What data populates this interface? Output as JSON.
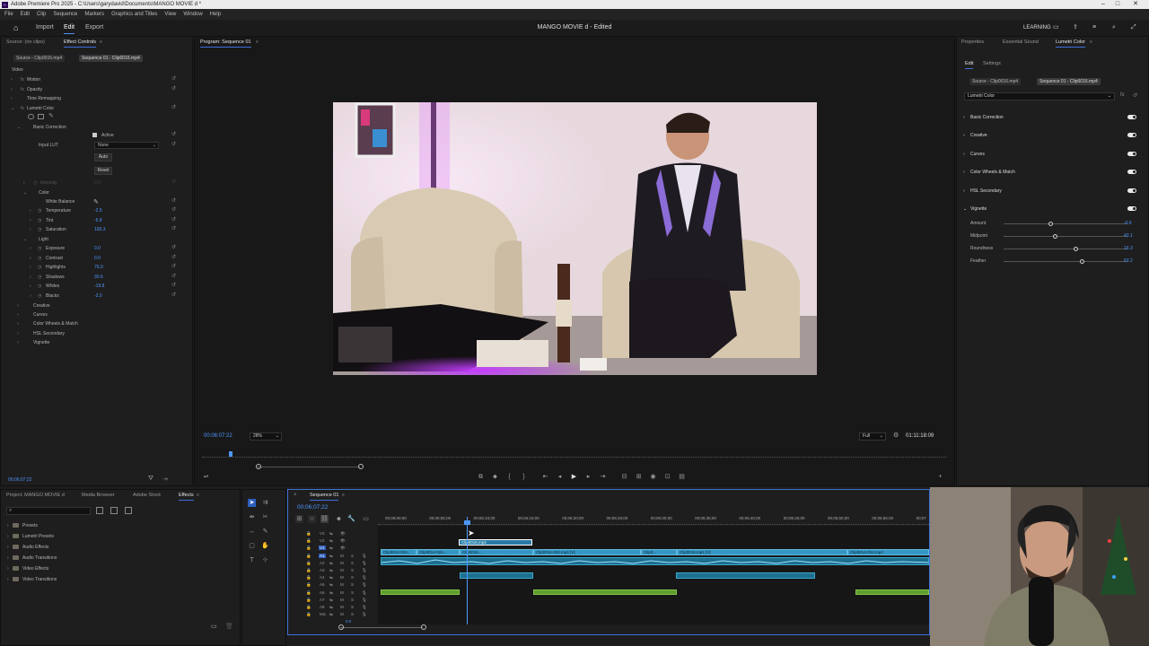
{
  "titlebar": {
    "title": "Adobe Premiere Pro 2025 - C:\\Users\\garydavid\\Documents\\MANGO MOVIE d *"
  },
  "menu": [
    "File",
    "Edit",
    "Clip",
    "Sequence",
    "Markers",
    "Graphics and Titles",
    "View",
    "Window",
    "Help"
  ],
  "workspace": {
    "tabs": [
      "Import",
      "Edit",
      "Export"
    ],
    "active_tab": "Edit",
    "project_title": "MANGO MOVIE d - Edited",
    "learning_label": "LEARNING"
  },
  "effect_controls": {
    "tabs": [
      "Source: (no clips)",
      "Effect Controls"
    ],
    "source_chip": "Source - Clip0016.mp4",
    "sequence_chip": "Sequence 01 - Clip0016.mp4",
    "section_video": "Video",
    "effects": [
      "Motion",
      "Opacity",
      "Time Remapping",
      "Lumetri Color"
    ],
    "basic_correction": "Basic Correction",
    "active_label": "Active",
    "input_lut_label": "Input LUT",
    "input_lut_value": "None",
    "auto_label": "Auto",
    "reset_label": "Reset",
    "intensity_label": "Intensity",
    "intensity_value": "0.0",
    "color_label": "Color",
    "white_balance_label": "White Balance",
    "color_params": [
      {
        "label": "Temperature",
        "value": "-2.5"
      },
      {
        "label": "Tint",
        "value": "-5.8"
      },
      {
        "label": "Saturation",
        "value": "100.3"
      }
    ],
    "light_label": "Light",
    "light_params": [
      {
        "label": "Exposure",
        "value": "0.0"
      },
      {
        "label": "Contrast",
        "value": "0.0"
      },
      {
        "label": "Highlights",
        "value": "76.0"
      },
      {
        "label": "Shadows",
        "value": "30.6"
      },
      {
        "label": "Whites",
        "value": "-19.8"
      },
      {
        "label": "Blacks",
        "value": "-2.0"
      }
    ],
    "sections": [
      "Creative",
      "Curves",
      "Color Wheels & Match",
      "HSL Secondary",
      "Vignette"
    ],
    "timecode": "00;06;07;22"
  },
  "program": {
    "title": "Program: Sequence 01",
    "timecode": "00:06:07:22",
    "zoom": "28%",
    "quality": "Full",
    "duration": "01:11:18:09"
  },
  "lumetri": {
    "tabs": [
      "Properties",
      "Essential Sound",
      "Lumetri Color"
    ],
    "subtabs": [
      "Edit",
      "Settings"
    ],
    "source_chip": "Source - Clip0016.mp4",
    "sequence_chip": "Sequence 01 - Clip0016.mp4",
    "effect_select": "Lumetri Color",
    "sections": [
      "Basic Correction",
      "Creative",
      "Curves",
      "Color Wheels & Match",
      "HSL Secondary",
      "Vignette"
    ],
    "vignette": [
      {
        "label": "Amount",
        "value": "-0.6",
        "pos": 0.38
      },
      {
        "label": "Midpoint",
        "value": "43.1",
        "pos": 0.41
      },
      {
        "label": "Roundness",
        "value": "16.3",
        "pos": 0.58
      },
      {
        "label": "Feather",
        "value": "63.2",
        "pos": 0.63
      }
    ]
  },
  "project": {
    "tabs": [
      "Project: MANGO MOVIE d",
      "Media Browser",
      "Adobe Stock",
      "Effects"
    ],
    "folders": [
      "Presets",
      "Lumetri Presets",
      "Audio Effects",
      "Audio Transitions",
      "Video Effects",
      "Video Transitions"
    ]
  },
  "timeline": {
    "title": "Sequence 01",
    "timecode": "00;06;07;22",
    "ruler": [
      "00;06;00;00",
      "00;06;05;00",
      "00;06;10;00",
      "00;06;15;00",
      "00;06;20;00",
      "00;06;25;00",
      "00;06;30;00",
      "00;06;35;00",
      "00;06;40;00",
      "00;06;45;00",
      "00;06;50;00",
      "00;06;55;00",
      "00;07"
    ],
    "tracks_video": [
      "V3",
      "V2",
      "V1"
    ],
    "tracks_audio": [
      "A1",
      "A2",
      "A3",
      "A4",
      "A5",
      "A6",
      "A7",
      "A8",
      "Mix"
    ],
    "mix_value": "0.0",
    "clips_v2": [
      "Clip0016.mp4"
    ],
    "clips_v1": [
      "Clip0014-024...",
      "Clip0014-024...",
      "Clip0016...",
      "Clip0014-024.mp4 [V]",
      "Clip0...",
      "Clip0015.mp4 [V]",
      "Clip0014-024.mp4"
    ]
  }
}
